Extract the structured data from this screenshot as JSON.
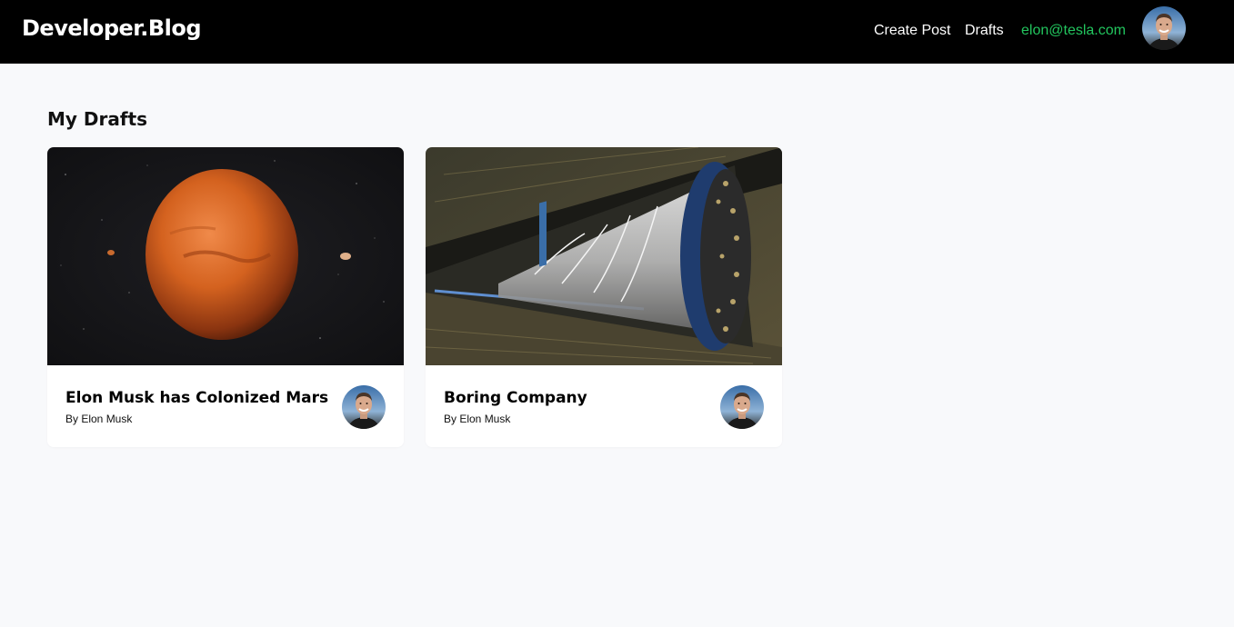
{
  "navbar": {
    "brand": "Developer.Blog",
    "links": {
      "create_post": "Create Post",
      "drafts": "Drafts"
    },
    "user_email": "elon@tesla.com",
    "email_color": "#22c55e"
  },
  "page": {
    "title": "My Drafts"
  },
  "drafts": [
    {
      "title": "Elon Musk has Colonized Mars",
      "author": "By Elon Musk",
      "image": "mars-planet-image"
    },
    {
      "title": "Boring Company",
      "author": "By Elon Musk",
      "image": "tunnel-boring-machine-image"
    }
  ]
}
